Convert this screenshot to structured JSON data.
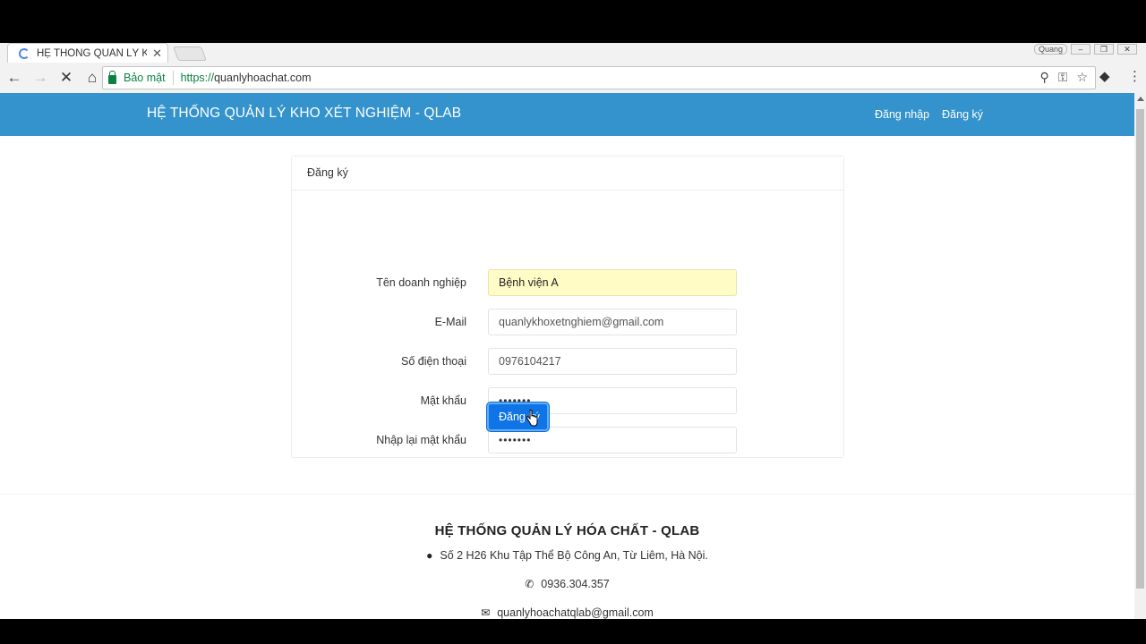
{
  "browser": {
    "tab_title": "HỆ THỐNG QUẢN LÝ KH",
    "tab_close": "✕",
    "secure_label": "Bảo mật",
    "url_scheme": "https://",
    "url_host": "quanlyhoachat.com",
    "user_label": "Quang"
  },
  "navbar": {
    "brand": "HỆ THỐNG QUẢN LÝ KHO XÉT NGHIỆM - QLAB",
    "links": [
      "Đăng nhập",
      "Đăng ký"
    ]
  },
  "card": {
    "header": "Đăng ký",
    "fields": [
      {
        "label": "Tên doanh nghiệp",
        "value": "Bệnh viện A"
      },
      {
        "label": "E-Mail",
        "value": "quanlykhoxetnghiem@gmail.com"
      },
      {
        "label": "Số điện thoại",
        "value": "0976104217"
      },
      {
        "label": "Mật khẩu",
        "value": "•••••••"
      },
      {
        "label": "Nhập lại mật khẩu",
        "value": "•••••••"
      }
    ],
    "submit_label": "Đăng ký"
  },
  "footer": {
    "title": "HỆ THỐNG QUẢN LÝ HÓA CHẤT - QLAB",
    "address": "Số 2 H26 Khu Tập Thể Bộ Công An, Từ Liêm, Hà Nội.",
    "phone": "0936.304.357",
    "email": "quanlyhoachatqlab@gmail.com"
  },
  "colors": {
    "navbar": "#3493cc",
    "button": "#1174e6",
    "autofill": "#fffcc6",
    "secure": "#0b8043"
  }
}
